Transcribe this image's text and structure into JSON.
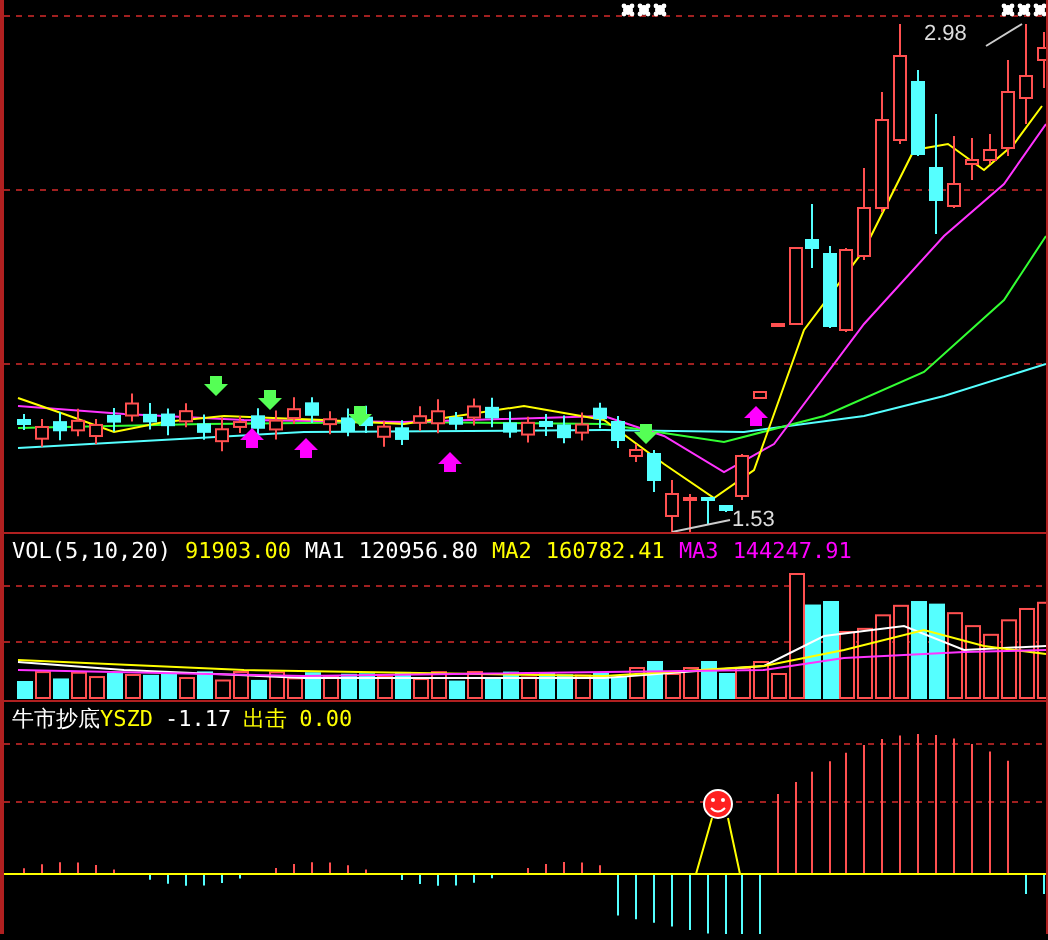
{
  "price_chart": {
    "high_label": "2.98",
    "low_label": "1.53"
  },
  "volume_panel": {
    "title": "VOL(5,10,20)",
    "readings": [
      {
        "text": "91903.00",
        "color": "#ffff00"
      },
      {
        "text": "MA1",
        "color": "#ffffff"
      },
      {
        "text": "120956.80",
        "color": "#ffffff"
      },
      {
        "text": "MA2",
        "color": "#ffff00"
      },
      {
        "text": "160782.41",
        "color": "#ffff00"
      },
      {
        "text": "MA3",
        "color": "#ff00ff"
      },
      {
        "text": "144247.91",
        "color": "#ff00ff"
      }
    ]
  },
  "indicator_panel": {
    "title": "牛市抄底",
    "readings": [
      {
        "text": "YSZD",
        "color": "#ffff00"
      },
      {
        "text": "-1.17",
        "color": "#ffffff"
      },
      {
        "text": "出击",
        "color": "#ffff00"
      },
      {
        "text": "0.00",
        "color": "#ffff00"
      }
    ]
  }
}
